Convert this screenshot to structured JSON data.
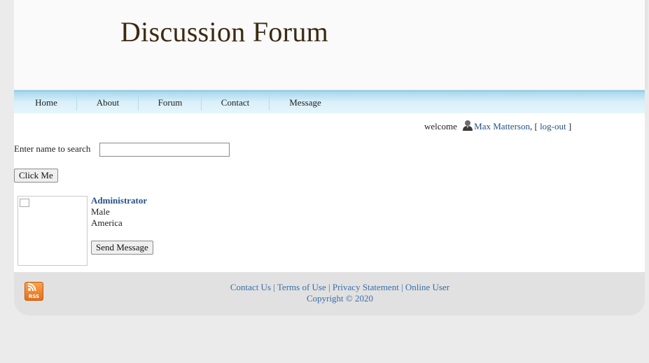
{
  "header": {
    "title": "Discussion Forum"
  },
  "nav": {
    "items": [
      {
        "label": "Home"
      },
      {
        "label": "About"
      },
      {
        "label": "Forum"
      },
      {
        "label": "Contact"
      },
      {
        "label": "Message"
      }
    ]
  },
  "welcome": {
    "greeting": "welcome",
    "user_name": "Max Matterson",
    "separator_open": ", [",
    "logout_label": "log-out",
    "separator_close": "]"
  },
  "search": {
    "label": "Enter name to search",
    "value": "",
    "button_label": "Click Me"
  },
  "profile": {
    "name": "Administrator",
    "gender": "Male",
    "location": "America",
    "send_message_label": "Send Message"
  },
  "footer": {
    "links": [
      {
        "label": "Contact Us"
      },
      {
        "label": "Terms of Use"
      },
      {
        "label": "Privacy Statement"
      },
      {
        "label": "Online User"
      }
    ],
    "separator": "|",
    "copyright": "Copyright © 2020",
    "rss_icon": "rss-icon",
    "rss_text": "RSS"
  },
  "colors": {
    "title": "#3b2a12",
    "link": "#24508a",
    "nav_gradient_top": "#a8d8ec",
    "nav_gradient_bottom": "#e7f6fc",
    "footer_bg": "#e1e1e1",
    "rss": "#f08a2a"
  }
}
